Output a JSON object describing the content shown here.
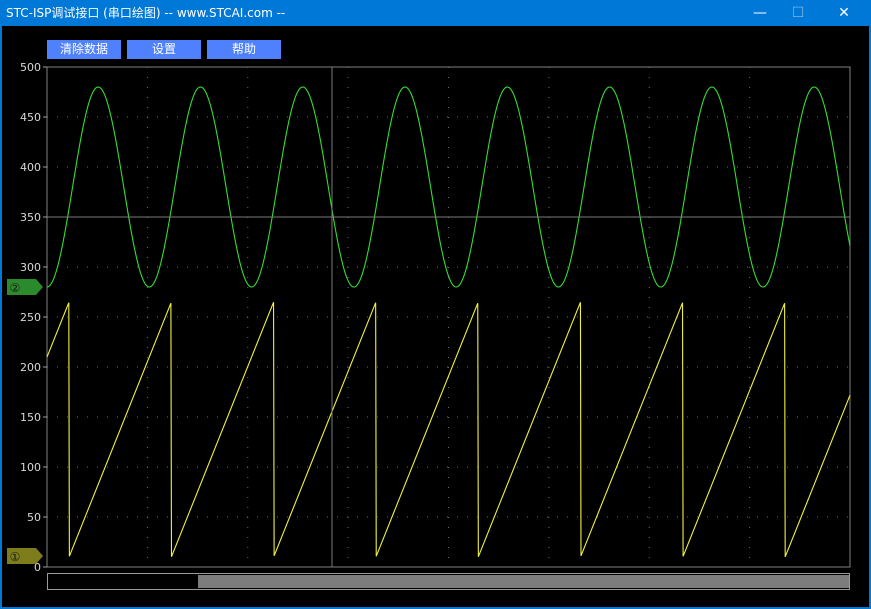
{
  "window": {
    "title": "STC-ISP调试接口 (串口绘图) -- www.STCAI.com --",
    "minimize_glyph": "—",
    "maximize_glyph": "☐",
    "close_glyph": "✕"
  },
  "toolbar": {
    "clear_label": "清除数据",
    "settings_label": "设置",
    "help_label": "帮助"
  },
  "channels": [
    {
      "marker": "①",
      "color": "#f2f23a"
    },
    {
      "marker": "②",
      "color": "#33dd33"
    }
  ],
  "colors": {
    "accent": "#4f81ff",
    "titlebar": "#0078d7",
    "plot_background": "#000000",
    "grid": "#808080"
  },
  "chart_data": {
    "type": "line",
    "ylim": [
      0,
      500
    ],
    "yticks": [
      0,
      50,
      100,
      150,
      200,
      250,
      300,
      350,
      400,
      450,
      500
    ],
    "grid": true,
    "cursor_y": 350,
    "series": [
      {
        "channel": 2,
        "shape": "sine",
        "color": "#33dd33",
        "min": 280,
        "max": 480,
        "cycles_visible": 7.85,
        "start_value": 280
      },
      {
        "channel": 1,
        "shape": "sawtooth",
        "color": "#f2f23a",
        "min": 10,
        "max": 265,
        "cycles_visible": 7.85,
        "start_value": 210
      }
    ]
  }
}
